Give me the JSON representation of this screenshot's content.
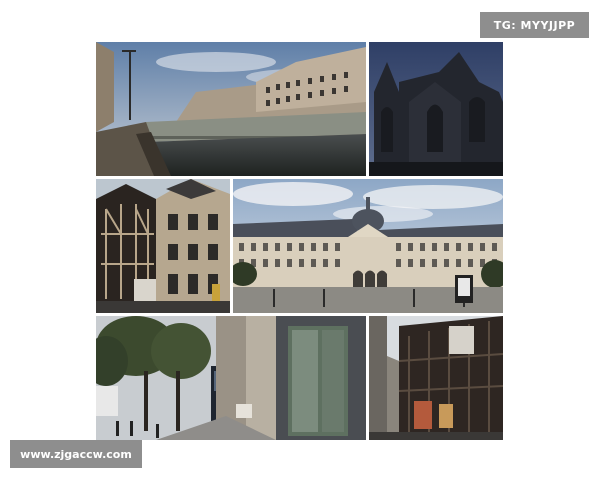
{
  "watermarks": {
    "top_right": "TG: MYYJJPP",
    "bottom_left": "www.zjgaccw.com"
  },
  "collage": {
    "tiles": [
      {
        "name": "canal-bridge-photo",
        "subject": "canal-with-bridge-and-buildings"
      },
      {
        "name": "gothic-church-photo",
        "subject": "gothic-church-facade"
      },
      {
        "name": "timber-houses-photo",
        "subject": "half-timbered-houses"
      },
      {
        "name": "palace-square-photo",
        "subject": "grand-palace-with-square"
      },
      {
        "name": "tree-street-photo",
        "subject": "tree-lined-street-with-shops"
      },
      {
        "name": "narrow-alley-photo",
        "subject": "narrow-street-old-facades"
      }
    ]
  },
  "colors": {
    "sky_blue": "#7d95b5",
    "sky_dark": "#2e3a5a",
    "stone": "#b9ad9a",
    "shadow": "#1f2228",
    "tree_green": "#3c4a2e",
    "watermark_bg": "#8e8e8e"
  }
}
